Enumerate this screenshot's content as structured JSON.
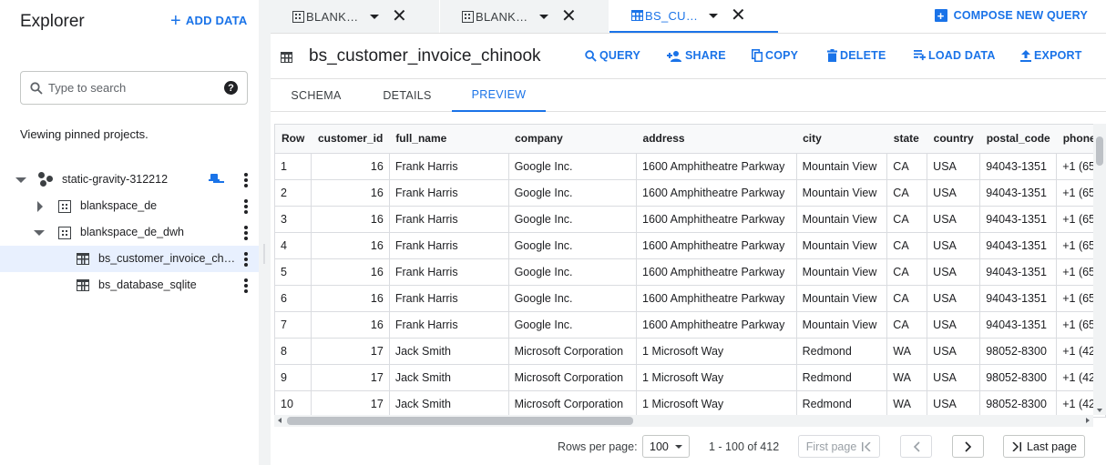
{
  "explorer": {
    "title": "Explorer",
    "add_data_label": "ADD DATA",
    "search_placeholder": "Type to search",
    "viewing_text": "Viewing pinned projects.",
    "tree": {
      "project": "static-gravity-312212",
      "dataset1": "blankspace_de",
      "dataset2": "blankspace_de_dwh",
      "table1": "bs_customer_invoice_chin…",
      "table2": "bs_database_sqlite"
    }
  },
  "tabs": [
    {
      "label": "BLANKS…"
    },
    {
      "label": "BLANKS…"
    },
    {
      "label": "BS_CUST…"
    }
  ],
  "compose_label": "COMPOSE NEW QUERY",
  "toolbar": {
    "title": "bs_customer_invoice_chinook",
    "query": "QUERY",
    "share": "SHARE",
    "copy": "COPY",
    "delete": "DELETE",
    "load": "LOAD DATA",
    "export": "EXPORT"
  },
  "subtabs": {
    "schema": "SCHEMA",
    "details": "DETAILS",
    "preview": "PREVIEW"
  },
  "grid": {
    "headers": [
      "Row",
      "customer_id",
      "full_name",
      "company",
      "address",
      "city",
      "state",
      "country",
      "postal_code",
      "phone"
    ],
    "rows": [
      [
        "1",
        "16",
        "Frank Harris",
        "Google Inc.",
        "1600 Amphitheatre Parkway",
        "Mountain View",
        "CA",
        "USA",
        "94043-1351",
        "+1 (65"
      ],
      [
        "2",
        "16",
        "Frank Harris",
        "Google Inc.",
        "1600 Amphitheatre Parkway",
        "Mountain View",
        "CA",
        "USA",
        "94043-1351",
        "+1 (65"
      ],
      [
        "3",
        "16",
        "Frank Harris",
        "Google Inc.",
        "1600 Amphitheatre Parkway",
        "Mountain View",
        "CA",
        "USA",
        "94043-1351",
        "+1 (65"
      ],
      [
        "4",
        "16",
        "Frank Harris",
        "Google Inc.",
        "1600 Amphitheatre Parkway",
        "Mountain View",
        "CA",
        "USA",
        "94043-1351",
        "+1 (65"
      ],
      [
        "5",
        "16",
        "Frank Harris",
        "Google Inc.",
        "1600 Amphitheatre Parkway",
        "Mountain View",
        "CA",
        "USA",
        "94043-1351",
        "+1 (65"
      ],
      [
        "6",
        "16",
        "Frank Harris",
        "Google Inc.",
        "1600 Amphitheatre Parkway",
        "Mountain View",
        "CA",
        "USA",
        "94043-1351",
        "+1 (65"
      ],
      [
        "7",
        "16",
        "Frank Harris",
        "Google Inc.",
        "1600 Amphitheatre Parkway",
        "Mountain View",
        "CA",
        "USA",
        "94043-1351",
        "+1 (65"
      ],
      [
        "8",
        "17",
        "Jack Smith",
        "Microsoft Corporation",
        "1 Microsoft Way",
        "Redmond",
        "WA",
        "USA",
        "98052-8300",
        "+1 (42"
      ],
      [
        "9",
        "17",
        "Jack Smith",
        "Microsoft Corporation",
        "1 Microsoft Way",
        "Redmond",
        "WA",
        "USA",
        "98052-8300",
        "+1 (42"
      ],
      [
        "10",
        "17",
        "Jack Smith",
        "Microsoft Corporation",
        "1 Microsoft Way",
        "Redmond",
        "WA",
        "USA",
        "98052-8300",
        "+1 (42"
      ]
    ]
  },
  "pager": {
    "rows_per_page_label": "Rows per page:",
    "rows_per_page_value": "100",
    "range": "1 - 100 of 412",
    "first_page": "First page",
    "last_page": "Last page"
  },
  "colors": {
    "accent": "#1a73e8",
    "selected_row_bg": "#e8f0fe"
  }
}
